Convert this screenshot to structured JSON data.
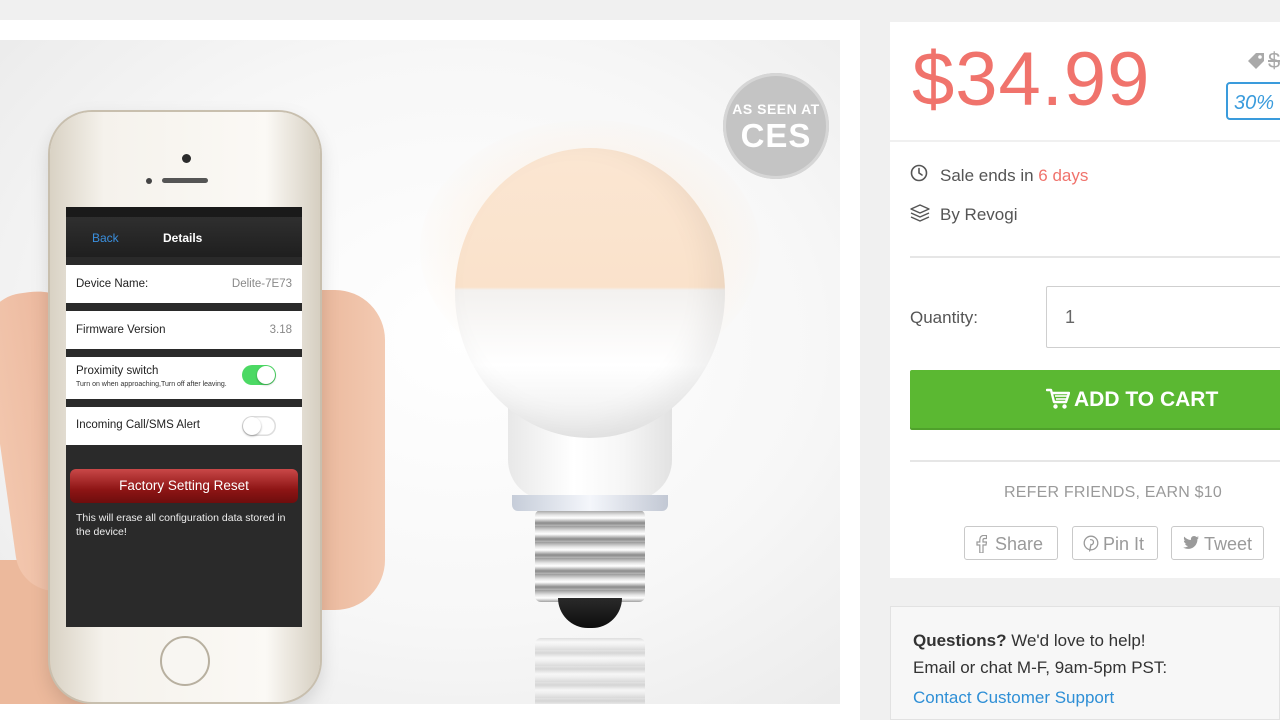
{
  "badge": {
    "line1": "AS SEEN AT",
    "line2": "CES"
  },
  "phone_app": {
    "nav_back": "Back",
    "nav_title": "Details",
    "device_name_label": "Device Name:",
    "device_name_value": "Delite-7E73",
    "firmware_label": "Firmware Version",
    "firmware_value": "3.18",
    "proximity_label": "Proximity switch",
    "proximity_sub": "Turn on when approaching,Turn off after leaving.",
    "proximity_on": true,
    "call_alert_label": "Incoming Call/SMS Alert",
    "call_alert_on": false,
    "reset_button": "Factory Setting Reset",
    "reset_note": "This will erase all configuration data stored in the device!"
  },
  "pricing": {
    "price": "$34.99",
    "old_price": "$",
    "discount": "30%"
  },
  "details": {
    "sale_prefix": "Sale ends in ",
    "sale_days": "6 days",
    "vendor": "By Revogi",
    "quantity_label": "Quantity:",
    "quantity_value": "1",
    "add_to_cart": "ADD TO CART",
    "refer": "REFER FRIENDS, EARN $10",
    "share_facebook": "Share",
    "share_pinterest": "Pin It",
    "share_twitter": "Tweet"
  },
  "help": {
    "question_bold": "Questions?",
    "question_rest": " We'd love to help!",
    "hours": "Email or chat M-F, 9am-5pm PST:",
    "contact_link": "Contact Customer Support"
  },
  "colors": {
    "price": "#f0736c",
    "accent_green": "#5bb832",
    "link_blue": "#2e8fd6",
    "discount_blue": "#3a9bdc"
  }
}
